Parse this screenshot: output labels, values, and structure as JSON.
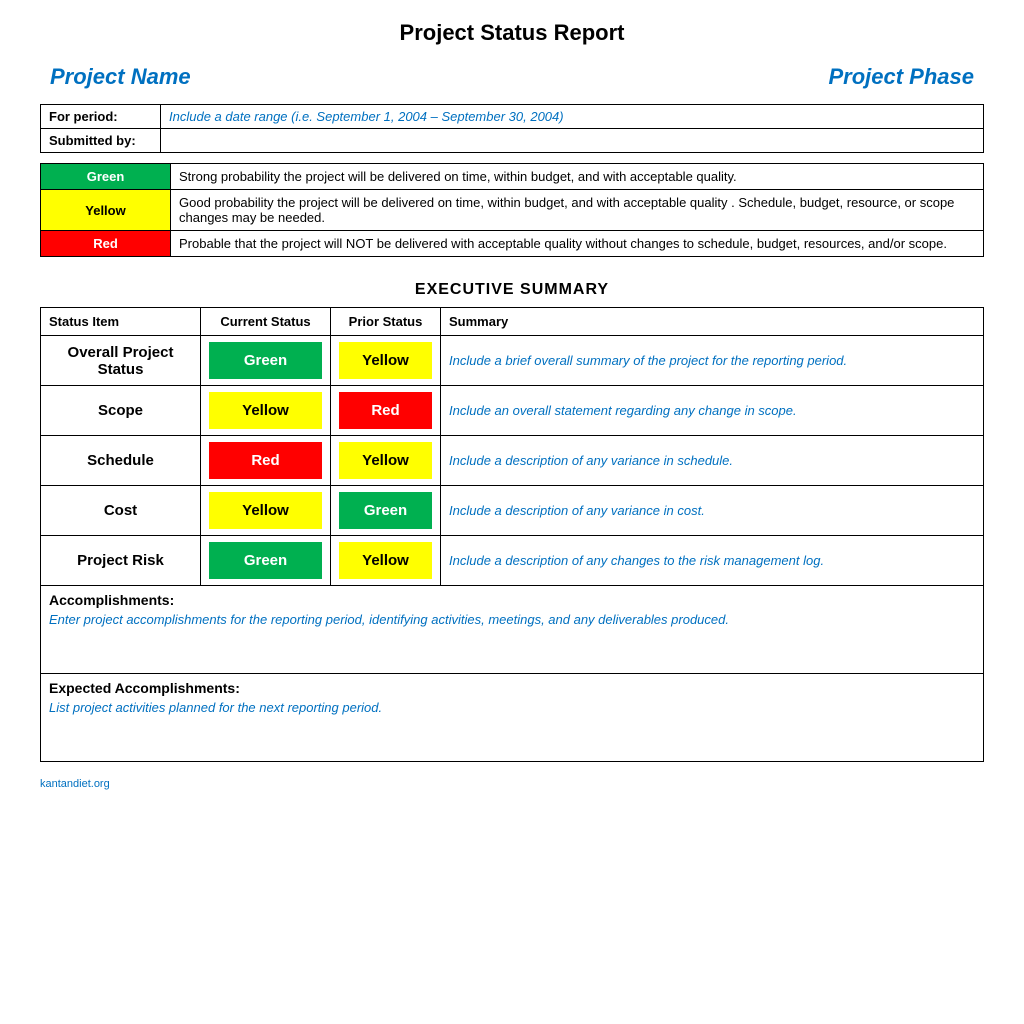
{
  "page": {
    "title": "Project Status Report",
    "project_name_label": "Project Name",
    "project_phase_label": "Project Phase"
  },
  "info": {
    "for_period_label": "For period:",
    "for_period_value": "Include a date range (i.e. September 1, 2004 – September 30, 2004)",
    "submitted_by_label": "Submitted by:",
    "submitted_by_value": ""
  },
  "legend": [
    {
      "color": "Green",
      "description": "Strong probability  the project will be delivered on time, within budget, and with acceptable quality."
    },
    {
      "color": "Yellow",
      "description": "Good probability  the project will be delivered on time, within budget, and with acceptable quality . Schedule, budget, resource, or scope changes may be needed."
    },
    {
      "color": "Red",
      "description": "Probable that the project will NOT be delivered with acceptable quality without changes to schedule, budget, resources, and/or scope."
    }
  ],
  "executive_summary": {
    "title": "EXECUTIVE SUMMARY",
    "headers": {
      "status_item": "Status Item",
      "current_status": "Current Status",
      "prior_status": "Prior Status",
      "summary": "Summary"
    },
    "rows": [
      {
        "status_item": "Overall Project Status",
        "current_status": "Green",
        "current_color": "green",
        "prior_status": "Yellow",
        "prior_color": "yellow",
        "summary": "Include a brief overall summary of the project for the reporting period."
      },
      {
        "status_item": "Scope",
        "current_status": "Yellow",
        "current_color": "yellow",
        "prior_status": "Red",
        "prior_color": "red",
        "summary": "Include an overall statement regarding any change in scope."
      },
      {
        "status_item": "Schedule",
        "current_status": "Red",
        "current_color": "red",
        "prior_status": "Yellow",
        "prior_color": "yellow",
        "summary": "Include a description of any variance in schedule."
      },
      {
        "status_item": "Cost",
        "current_status": "Yellow",
        "current_color": "yellow",
        "prior_status": "Green",
        "prior_color": "green",
        "summary": "Include a description of any variance in cost."
      },
      {
        "status_item": "Project Risk",
        "current_status": "Green",
        "current_color": "green",
        "prior_status": "Yellow",
        "prior_color": "yellow",
        "summary": "Include a description of any changes to the risk management log."
      }
    ],
    "accomplishments_label": "Accomplishments:",
    "accomplishments_text": "Enter project accomplishments for the reporting period, identifying activities, meetings, and any deliverables produced.",
    "expected_accomplishments_label": "Expected Accomplishments:",
    "expected_accomplishments_text": "List project activities planned for the next reporting period."
  },
  "footer": {
    "text": "kantandiet.org"
  }
}
